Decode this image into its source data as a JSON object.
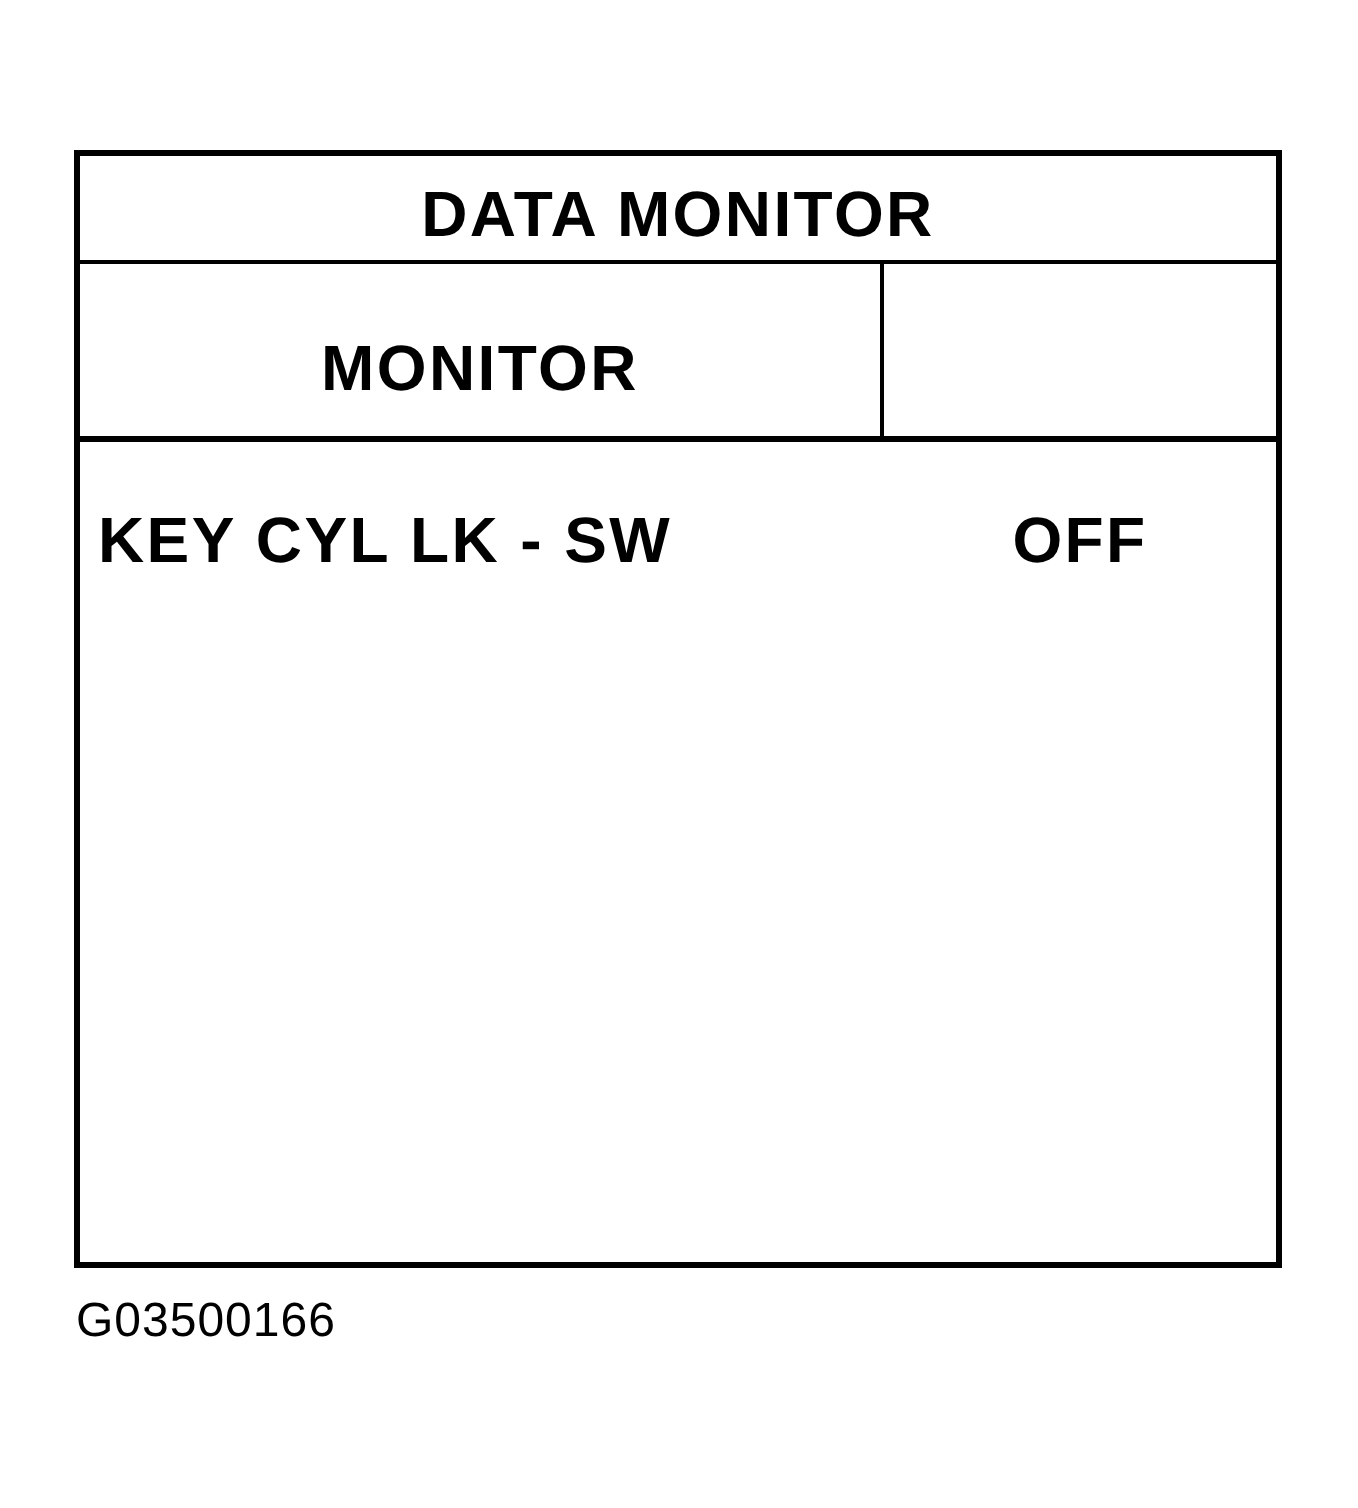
{
  "table": {
    "title": "DATA MONITOR",
    "header": "MONITOR",
    "rows": [
      {
        "item": "KEY CYL LK - SW",
        "value": "OFF"
      }
    ]
  },
  "caption": "G03500166"
}
